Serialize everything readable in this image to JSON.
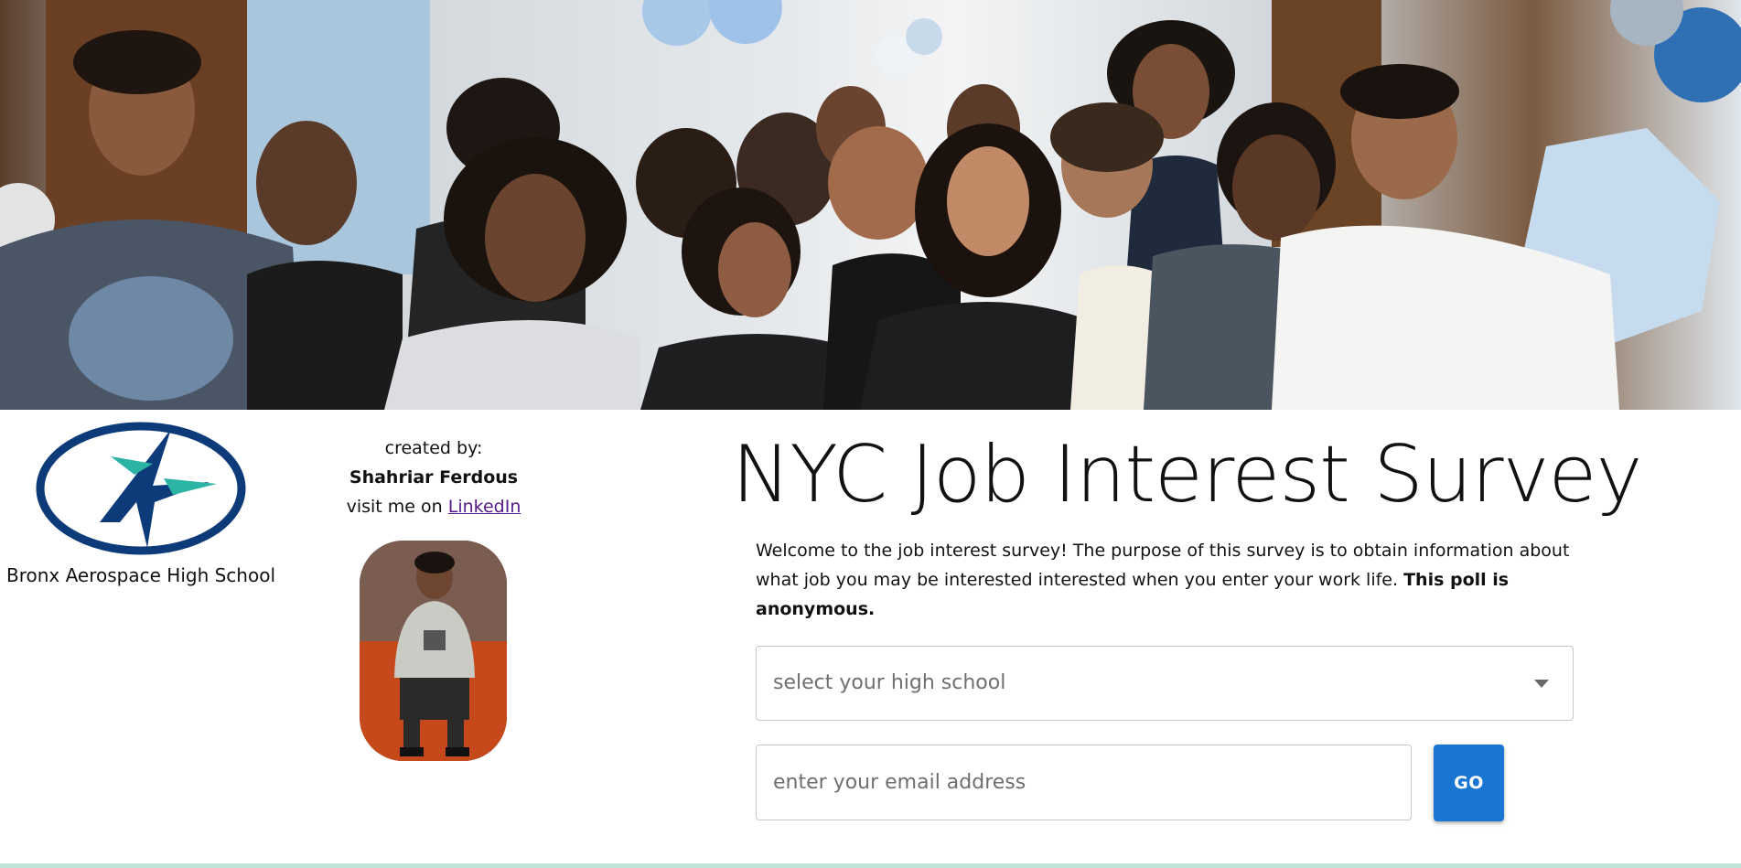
{
  "hero": {
    "image": "group-photo-students-hallway"
  },
  "school": {
    "logo_icon": "aerospace-star-logo-icon",
    "name": "Bronx Aerospace High School",
    "logo_colors": {
      "ring": "#0d3b7a",
      "accent": "#2bb3a3"
    }
  },
  "creator": {
    "created_by_label": "created by:",
    "author_name": "Shahriar Ferdous",
    "visit_prefix": "visit me on ",
    "link_label": "LinkedIn",
    "photo": "author-portrait-photo"
  },
  "main": {
    "title": "NYC Job Interest Survey",
    "intro_text": "Welcome to the job interest survey! The purpose of this survey is to obtain information about what job you may be interested interested when you enter your work life. ",
    "intro_bold": "This poll is anonymous.",
    "school_select": {
      "placeholder": "select your high school",
      "icon": "chevron-down-icon"
    },
    "email_input": {
      "placeholder": "enter your email address",
      "value": ""
    },
    "go_button_label": "GO"
  },
  "colors": {
    "button": "#1976d2",
    "link": "#551a8b",
    "bottom_line": "#bfe3d8"
  }
}
